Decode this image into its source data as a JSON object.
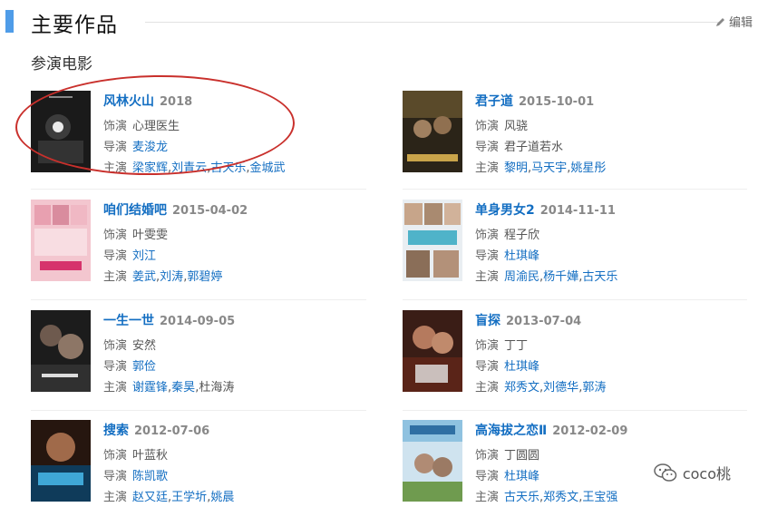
{
  "section": {
    "title": "主要作品",
    "edit_label": "编辑",
    "subtitle": "参演电影"
  },
  "labels": {
    "role": "饰演",
    "director": "导演",
    "cast": "主演"
  },
  "films": [
    {
      "title": "风林火山",
      "date": "2018",
      "role": "心理医生",
      "director": "麦浚龙",
      "cast": [
        "梁家辉",
        "刘青云",
        "古天乐",
        "金城武"
      ]
    },
    {
      "title": "君子道",
      "date": "2015-10-01",
      "role": "风骁",
      "director": "君子道若水",
      "cast": [
        "黎明",
        "马天宇",
        "姚星彤"
      ]
    },
    {
      "title": "咱们结婚吧",
      "date": "2015-04-02",
      "role": "叶雯雯",
      "director": "刘江",
      "cast": [
        "姜武",
        "刘涛",
        "郭碧婷"
      ]
    },
    {
      "title": "单身男女2",
      "date": "2014-11-11",
      "role": "程子欣",
      "director": "杜琪峰",
      "cast": [
        "周渝民",
        "杨千嬅",
        "古天乐"
      ]
    },
    {
      "title": "一生一世",
      "date": "2014-09-05",
      "role": "安然",
      "director": "郭俭",
      "cast": [
        "谢霆锋",
        "秦昊",
        "杜海涛"
      ]
    },
    {
      "title": "盲探",
      "date": "2013-07-04",
      "role": "丁丁",
      "director": "杜琪峰",
      "cast": [
        "郑秀文",
        "刘德华",
        "郭涛"
      ]
    },
    {
      "title": "搜索",
      "date": "2012-07-06",
      "role": "叶蓝秋",
      "director": "陈凯歌",
      "cast": [
        "赵又廷",
        "王学圻",
        "姚晨"
      ]
    },
    {
      "title": "高海拔之恋Ⅱ",
      "date": "2012-02-09",
      "role": "丁圆圆",
      "director": "杜琪峰",
      "cast": [
        "古天乐",
        "郑秀文",
        "王宝强"
      ]
    }
  ],
  "colors": {
    "accent": "#4f9ce8",
    "link": "#136ec2",
    "annotation": "#c9302c"
  },
  "watermark": {
    "text": "coco桃",
    "icon": "wechat-icon"
  }
}
